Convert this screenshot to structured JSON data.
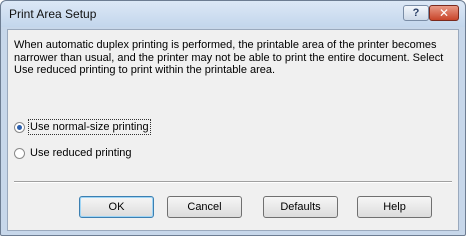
{
  "window": {
    "title": "Print Area Setup",
    "help_glyph": "?",
    "close_glyph": "✕"
  },
  "message": "When automatic duplex printing is performed, the printable area of the printer becomes narrower than usual, and the printer may not be able to print the entire document. Select Use reduced printing to print within the printable area.",
  "options": [
    {
      "label": "Use normal-size printing",
      "selected": true
    },
    {
      "label": "Use reduced printing",
      "selected": false
    }
  ],
  "buttons": {
    "ok": "OK",
    "cancel": "Cancel",
    "defaults": "Defaults",
    "help": "Help"
  },
  "colors": {
    "titlebar": "#c3d6ec",
    "close_button": "#c8452a",
    "radio_selected": "#2b5fae"
  }
}
